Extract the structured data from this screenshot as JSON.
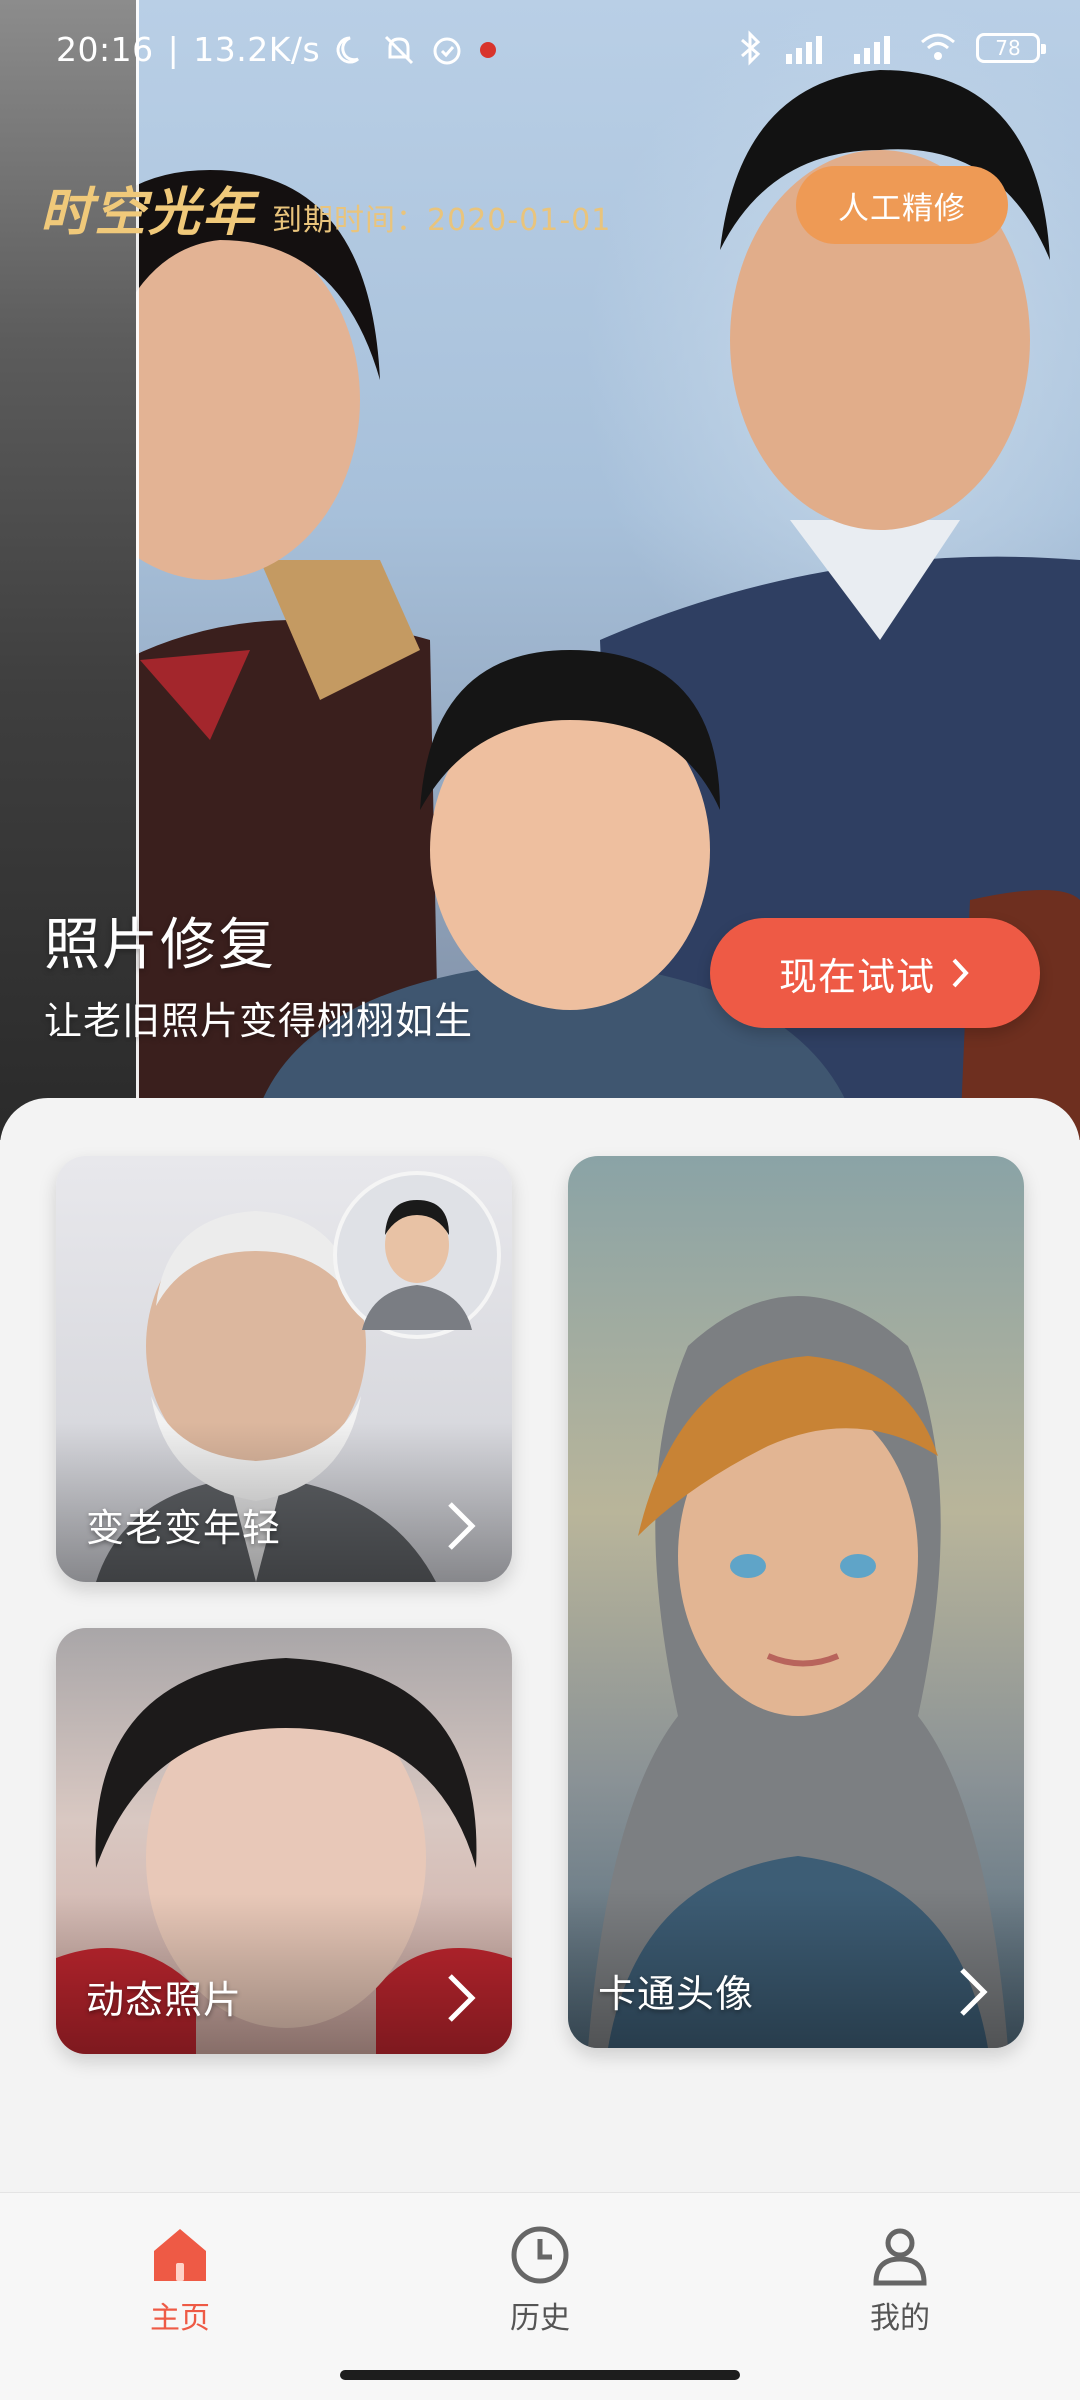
{
  "status_bar": {
    "time": "20:16",
    "speed": "13.2K/s",
    "battery": "78"
  },
  "brand": {
    "title": "时空光年",
    "expiry": "到期时间：2020-01-01"
  },
  "hero": {
    "manual_btn": "人工精修",
    "title": "照片修复",
    "subtitle": "让老旧照片变得栩栩如生",
    "try_btn": "现在试试"
  },
  "cards": {
    "age": "变老变年轻",
    "live": "动态照片",
    "cartoon": "卡通头像"
  },
  "tabs": {
    "home": "主页",
    "history": "历史",
    "mine": "我的"
  },
  "colors": {
    "accent": "#ee5a45",
    "orange": "#ee9a55",
    "gold": "#f0c97a"
  }
}
